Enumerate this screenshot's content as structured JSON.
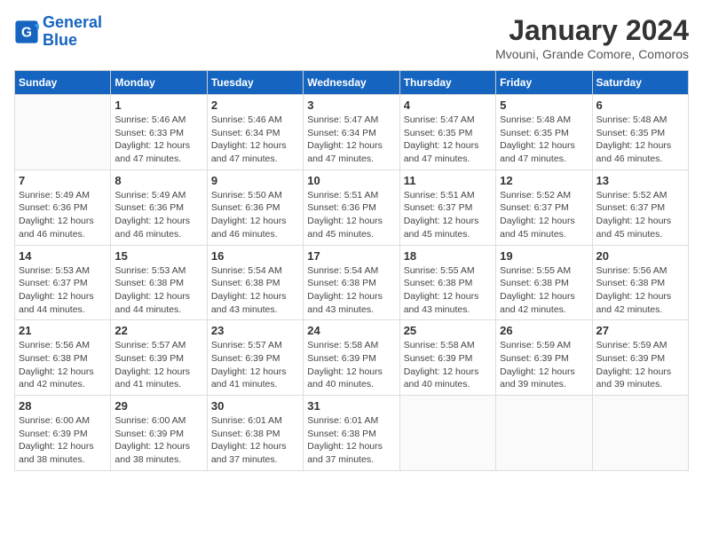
{
  "header": {
    "logo": {
      "line1": "General",
      "line2": "Blue"
    },
    "title": "January 2024",
    "subtitle": "Mvouni, Grande Comore, Comoros"
  },
  "days_of_week": [
    "Sunday",
    "Monday",
    "Tuesday",
    "Wednesday",
    "Thursday",
    "Friday",
    "Saturday"
  ],
  "weeks": [
    [
      {
        "day": "",
        "info": ""
      },
      {
        "day": "1",
        "info": "Sunrise: 5:46 AM\nSunset: 6:33 PM\nDaylight: 12 hours and 47 minutes."
      },
      {
        "day": "2",
        "info": "Sunrise: 5:46 AM\nSunset: 6:34 PM\nDaylight: 12 hours and 47 minutes."
      },
      {
        "day": "3",
        "info": "Sunrise: 5:47 AM\nSunset: 6:34 PM\nDaylight: 12 hours and 47 minutes."
      },
      {
        "day": "4",
        "info": "Sunrise: 5:47 AM\nSunset: 6:35 PM\nDaylight: 12 hours and 47 minutes."
      },
      {
        "day": "5",
        "info": "Sunrise: 5:48 AM\nSunset: 6:35 PM\nDaylight: 12 hours and 47 minutes."
      },
      {
        "day": "6",
        "info": "Sunrise: 5:48 AM\nSunset: 6:35 PM\nDaylight: 12 hours and 46 minutes."
      }
    ],
    [
      {
        "day": "7",
        "info": "Sunrise: 5:49 AM\nSunset: 6:36 PM\nDaylight: 12 hours and 46 minutes."
      },
      {
        "day": "8",
        "info": "Sunrise: 5:49 AM\nSunset: 6:36 PM\nDaylight: 12 hours and 46 minutes."
      },
      {
        "day": "9",
        "info": "Sunrise: 5:50 AM\nSunset: 6:36 PM\nDaylight: 12 hours and 46 minutes."
      },
      {
        "day": "10",
        "info": "Sunrise: 5:51 AM\nSunset: 6:36 PM\nDaylight: 12 hours and 45 minutes."
      },
      {
        "day": "11",
        "info": "Sunrise: 5:51 AM\nSunset: 6:37 PM\nDaylight: 12 hours and 45 minutes."
      },
      {
        "day": "12",
        "info": "Sunrise: 5:52 AM\nSunset: 6:37 PM\nDaylight: 12 hours and 45 minutes."
      },
      {
        "day": "13",
        "info": "Sunrise: 5:52 AM\nSunset: 6:37 PM\nDaylight: 12 hours and 45 minutes."
      }
    ],
    [
      {
        "day": "14",
        "info": "Sunrise: 5:53 AM\nSunset: 6:37 PM\nDaylight: 12 hours and 44 minutes."
      },
      {
        "day": "15",
        "info": "Sunrise: 5:53 AM\nSunset: 6:38 PM\nDaylight: 12 hours and 44 minutes."
      },
      {
        "day": "16",
        "info": "Sunrise: 5:54 AM\nSunset: 6:38 PM\nDaylight: 12 hours and 43 minutes."
      },
      {
        "day": "17",
        "info": "Sunrise: 5:54 AM\nSunset: 6:38 PM\nDaylight: 12 hours and 43 minutes."
      },
      {
        "day": "18",
        "info": "Sunrise: 5:55 AM\nSunset: 6:38 PM\nDaylight: 12 hours and 43 minutes."
      },
      {
        "day": "19",
        "info": "Sunrise: 5:55 AM\nSunset: 6:38 PM\nDaylight: 12 hours and 42 minutes."
      },
      {
        "day": "20",
        "info": "Sunrise: 5:56 AM\nSunset: 6:38 PM\nDaylight: 12 hours and 42 minutes."
      }
    ],
    [
      {
        "day": "21",
        "info": "Sunrise: 5:56 AM\nSunset: 6:38 PM\nDaylight: 12 hours and 42 minutes."
      },
      {
        "day": "22",
        "info": "Sunrise: 5:57 AM\nSunset: 6:39 PM\nDaylight: 12 hours and 41 minutes."
      },
      {
        "day": "23",
        "info": "Sunrise: 5:57 AM\nSunset: 6:39 PM\nDaylight: 12 hours and 41 minutes."
      },
      {
        "day": "24",
        "info": "Sunrise: 5:58 AM\nSunset: 6:39 PM\nDaylight: 12 hours and 40 minutes."
      },
      {
        "day": "25",
        "info": "Sunrise: 5:58 AM\nSunset: 6:39 PM\nDaylight: 12 hours and 40 minutes."
      },
      {
        "day": "26",
        "info": "Sunrise: 5:59 AM\nSunset: 6:39 PM\nDaylight: 12 hours and 39 minutes."
      },
      {
        "day": "27",
        "info": "Sunrise: 5:59 AM\nSunset: 6:39 PM\nDaylight: 12 hours and 39 minutes."
      }
    ],
    [
      {
        "day": "28",
        "info": "Sunrise: 6:00 AM\nSunset: 6:39 PM\nDaylight: 12 hours and 38 minutes."
      },
      {
        "day": "29",
        "info": "Sunrise: 6:00 AM\nSunset: 6:39 PM\nDaylight: 12 hours and 38 minutes."
      },
      {
        "day": "30",
        "info": "Sunrise: 6:01 AM\nSunset: 6:38 PM\nDaylight: 12 hours and 37 minutes."
      },
      {
        "day": "31",
        "info": "Sunrise: 6:01 AM\nSunset: 6:38 PM\nDaylight: 12 hours and 37 minutes."
      },
      {
        "day": "",
        "info": ""
      },
      {
        "day": "",
        "info": ""
      },
      {
        "day": "",
        "info": ""
      }
    ]
  ]
}
